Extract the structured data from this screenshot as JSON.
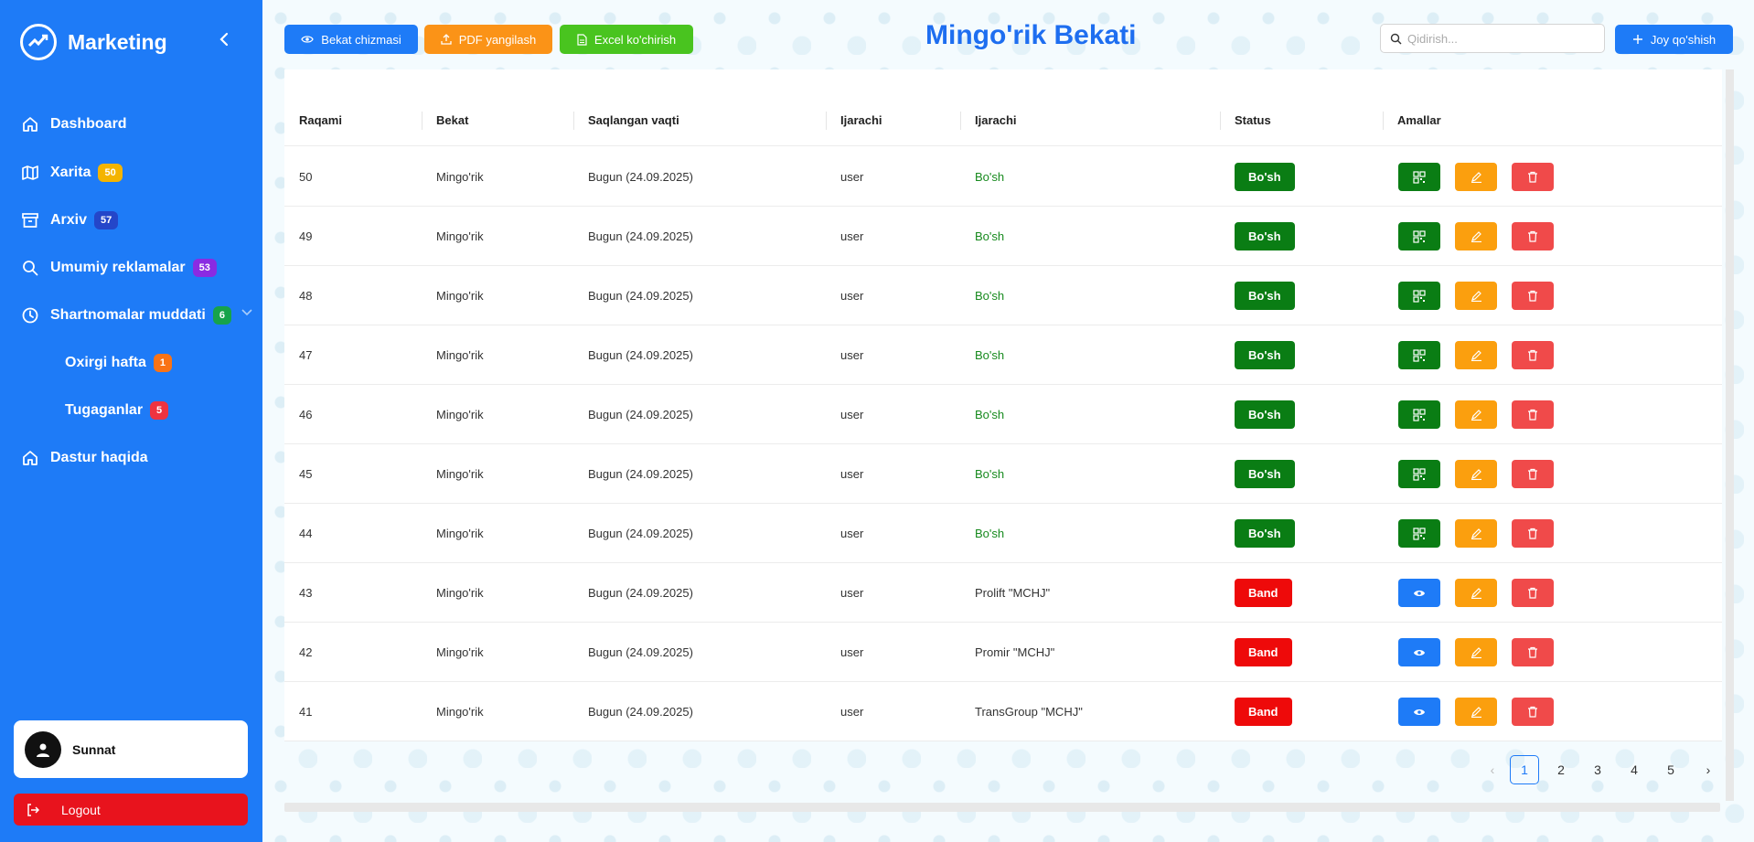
{
  "sidebar": {
    "brand": "Marketing",
    "items": [
      {
        "label": "Dashboard",
        "badge": null
      },
      {
        "label": "Xarita",
        "badge": "50"
      },
      {
        "label": "Arxiv",
        "badge": "57"
      },
      {
        "label": "Umumiy reklamalar",
        "badge": "53"
      },
      {
        "label": "Shartnomalar muddati",
        "badge": "6"
      },
      {
        "label": "Oxirgi hafta",
        "badge": "1"
      },
      {
        "label": "Tugaganlar",
        "badge": "5"
      },
      {
        "label": "Dastur haqida",
        "badge": null
      }
    ],
    "user": "Sunnat",
    "logout": "Logout"
  },
  "toolbar": {
    "btn_scheme": "Bekat chizmasi",
    "btn_pdf": "PDF yangilash",
    "btn_excel": "Excel ko'chirish",
    "title": "Mingo'rik Bekati",
    "search_placeholder": "Qidirish...",
    "btn_add": "Joy qo'shish"
  },
  "table": {
    "headers": [
      "Raqami",
      "Bekat",
      "Saqlangan vaqti",
      "Ijarachi",
      "Ijarachi",
      "Status",
      "Amallar"
    ],
    "rows": [
      {
        "num": "50",
        "station": "Mingo'rik",
        "saved": "Bugun (24.09.2025)",
        "user": "user",
        "tenant": "Bo'sh",
        "status": "Bo'sh",
        "free": true
      },
      {
        "num": "49",
        "station": "Mingo'rik",
        "saved": "Bugun (24.09.2025)",
        "user": "user",
        "tenant": "Bo'sh",
        "status": "Bo'sh",
        "free": true
      },
      {
        "num": "48",
        "station": "Mingo'rik",
        "saved": "Bugun (24.09.2025)",
        "user": "user",
        "tenant": "Bo'sh",
        "status": "Bo'sh",
        "free": true
      },
      {
        "num": "47",
        "station": "Mingo'rik",
        "saved": "Bugun (24.09.2025)",
        "user": "user",
        "tenant": "Bo'sh",
        "status": "Bo'sh",
        "free": true
      },
      {
        "num": "46",
        "station": "Mingo'rik",
        "saved": "Bugun (24.09.2025)",
        "user": "user",
        "tenant": "Bo'sh",
        "status": "Bo'sh",
        "free": true
      },
      {
        "num": "45",
        "station": "Mingo'rik",
        "saved": "Bugun (24.09.2025)",
        "user": "user",
        "tenant": "Bo'sh",
        "status": "Bo'sh",
        "free": true
      },
      {
        "num": "44",
        "station": "Mingo'rik",
        "saved": "Bugun (24.09.2025)",
        "user": "user",
        "tenant": "Bo'sh",
        "status": "Bo'sh",
        "free": true
      },
      {
        "num": "43",
        "station": "Mingo'rik",
        "saved": "Bugun (24.09.2025)",
        "user": "user",
        "tenant": "Prolift \"MCHJ\"",
        "status": "Band",
        "free": false
      },
      {
        "num": "42",
        "station": "Mingo'rik",
        "saved": "Bugun (24.09.2025)",
        "user": "user",
        "tenant": "Promir \"MCHJ\"",
        "status": "Band",
        "free": false
      },
      {
        "num": "41",
        "station": "Mingo'rik",
        "saved": "Bugun (24.09.2025)",
        "user": "user",
        "tenant": "TransGroup \"MCHJ\"",
        "status": "Band",
        "free": false
      }
    ]
  },
  "pagination": {
    "prev": "‹",
    "pages": [
      "1",
      "2",
      "3",
      "4",
      "5"
    ],
    "current": "1",
    "next": "›"
  }
}
